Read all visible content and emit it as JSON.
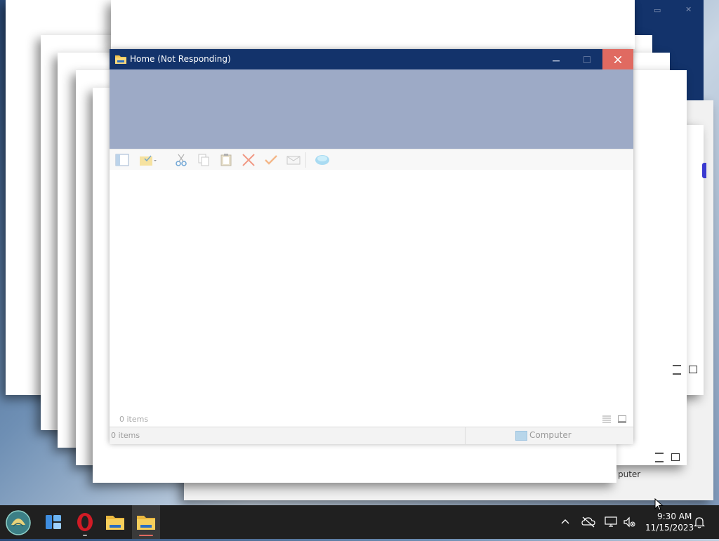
{
  "window": {
    "title": "Home (Not Responding)",
    "controls": {
      "minimize": "minimize",
      "maximize": "maximize",
      "close": "close"
    },
    "toolbar_icons": [
      "navigation-pane-icon",
      "properties-icon",
      "cut-icon",
      "copy-icon",
      "paste-icon",
      "delete-icon",
      "rename-icon",
      "email-icon",
      "map-drive-icon"
    ],
    "status_inner_text": "0 items",
    "statusbar": {
      "item_count": "0 items",
      "location": "Computer"
    }
  },
  "background": {
    "partial_status_text": "puter"
  },
  "taskbar": {
    "apps": [
      "start-button",
      "widgets",
      "opera-browser",
      "file-explorer",
      "file-explorer-active"
    ],
    "clock": {
      "time": "9:30 AM",
      "date": "11/15/2023"
    },
    "tray_icons": [
      "chevron-up-icon",
      "onedrive-icon",
      "network-icon",
      "volume-muted-icon",
      "notification-icon"
    ]
  },
  "colors": {
    "titlebar": "#13336b",
    "ribbon": "#9daac6",
    "close_button": "#e06a61",
    "taskbar": "#202020"
  }
}
